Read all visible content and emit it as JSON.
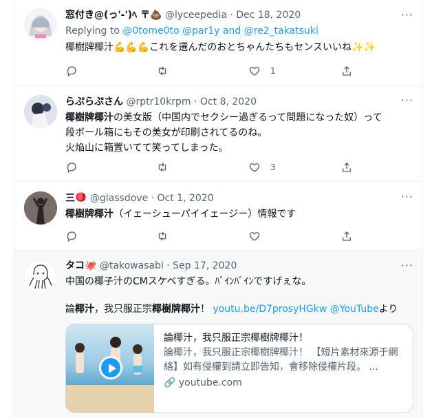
{
  "tweets": [
    {
      "name": "窓付き@(っ'-')ﾍ 〒💩",
      "handle": "@lyceepedia",
      "sep": "·",
      "date": "Dec 18, 2020",
      "reply_prefix": "Replying to",
      "reply_to": [
        "@0tome0to",
        "@par1y",
        "and",
        "@re2_takatsuki"
      ],
      "text": "椰樹牌椰汁💪💪💪これを選んだのおとちゃんたちもセンスいいね✨✨",
      "likes": "1"
    },
    {
      "name": "らぷらぷさん",
      "handle": "@rptr10krpm",
      "sep": "·",
      "date": "Oct 8, 2020",
      "lines": [
        {
          "bold": "椰樹牌椰汁",
          "rest": "の美女版（中国内でセクシー過ぎるって問題になった奴）って"
        },
        {
          "bold": "",
          "rest": "段ボール箱にもその美女が印刷されてるのね。"
        },
        {
          "bold": "",
          "rest": "火焔山に箱置いてて笑ってしまった。"
        }
      ],
      "likes": "3"
    },
    {
      "name": "三🪀",
      "handle": "@glassdove",
      "sep": "·",
      "date": "Oct 1, 2020",
      "bold": "椰樹牌椰汁",
      "rest": "（イェーシューパイイェージー）情報です",
      "likes": ""
    },
    {
      "name": "タコ🐙",
      "handle": "@takowasabi",
      "sep": "·",
      "date": "Sep 17, 2020",
      "line1": "中国の椰子汁のCMスケベすぎる。ﾊﾞｲﾝﾊﾞｲﾝですげぇな。",
      "line2": {
        "p1": "論",
        "b1": "椰汁",
        "p2": "，我只服正宗",
        "b2": "椰樹牌椰汁",
        "p3": "！  ",
        "link": "youtu.be/D7prosyHGkw",
        "mention": "@YouTube",
        "tail": "より"
      },
      "card": {
        "title": "論椰汁，我只服正宗椰樹牌椰汁！",
        "desc": "論椰汁，我只服正宗椰樹牌椰汁！ 【短片素材來源于網絡】如有侵權到請立即告知，會移除侵權片段。 ...",
        "domain": "🔗 youtube.com"
      }
    }
  ],
  "colors": {
    "accent": "#1d9bf0",
    "secondary": "#536471",
    "text": "#0f1419",
    "highlight_bg": "#f7f9f9"
  },
  "icons": [
    "reply-icon",
    "retweet-icon",
    "like-icon",
    "share-icon",
    "more-icon",
    "play-icon",
    "link-icon"
  ]
}
